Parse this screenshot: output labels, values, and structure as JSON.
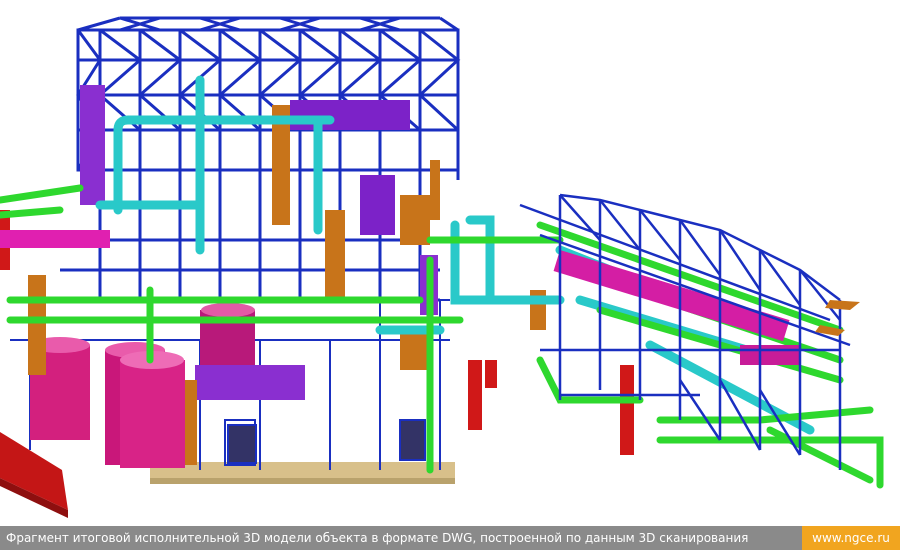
{
  "caption": {
    "text": "Фрагмент итоговой исполнительной 3D модели объекта в формате DWG, построенной по данным 3D сканирования",
    "url": "www.ngce.ru"
  },
  "colors": {
    "steel": "#1a2fc0",
    "cyan_pipe": "#29c9c9",
    "green_pipe": "#2ed82e",
    "magenta": "#e0209c",
    "purple": "#8a2fd0",
    "orange": "#c8741a",
    "red": "#d01818",
    "platform": "#d8c08a",
    "caption_bg": "#8a8a8a",
    "url_bg": "#f1a51f"
  }
}
